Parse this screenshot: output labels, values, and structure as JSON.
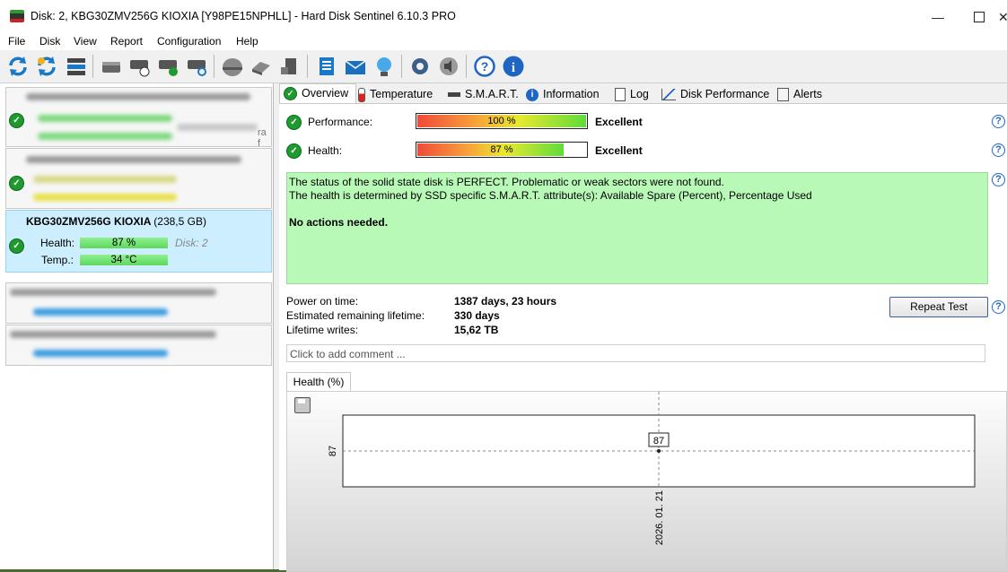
{
  "window": {
    "title": "Disk: 2, KBG30ZMV256G KIOXIA [Y98PE15NPHLL]  -  Hard Disk Sentinel 6.10.3 PRO"
  },
  "menu": [
    "File",
    "Disk",
    "View",
    "Report",
    "Configuration",
    "Help"
  ],
  "disk_list": {
    "selected": {
      "name": "KBG30ZMV256G KIOXIA",
      "size": "(238,5 GB)",
      "health_label": "Health:",
      "health_value": "87 %",
      "health_pct": 87,
      "disk_label": "Disk: 2",
      "temp_label": "Temp.:",
      "temp_value": "34 °C"
    },
    "fragment_text": "ra f"
  },
  "tabs": [
    "Overview",
    "Temperature",
    "S.M.A.R.T.",
    "Information",
    "Log",
    "Disk Performance",
    "Alerts"
  ],
  "overview": {
    "performance": {
      "label": "Performance:",
      "value": "100 %",
      "pct": 100,
      "rating": "Excellent"
    },
    "health": {
      "label": "Health:",
      "value": "87 %",
      "pct": 87,
      "rating": "Excellent"
    },
    "status_lines": [
      "The status of the solid state disk is PERFECT. Problematic or weak sectors were not found.",
      "The health is determined by SSD specific S.M.A.R.T. attribute(s):  Available Spare (Percent), Percentage Used"
    ],
    "status_action": "No actions needed.",
    "power_on_label": "Power on time:",
    "power_on_value": "1387 days, 23 hours",
    "lifetime_label": "Estimated remaining lifetime:",
    "lifetime_value": "330 days",
    "writes_label": "Lifetime writes:",
    "writes_value": "15,62 TB",
    "repeat_button": "Repeat Test",
    "comment_placeholder": "Click to add comment ..."
  },
  "chart_data": {
    "type": "line",
    "tab_label": "Health (%)",
    "x": [
      "2026. 01. 21"
    ],
    "series": [
      {
        "values": [
          87
        ]
      }
    ],
    "data_labels": [
      "87"
    ],
    "y_tick_labels": [
      "87"
    ],
    "grid": false
  },
  "colors": {
    "accent": "#1f66c4",
    "ok_green": "#1f9a2f",
    "status_bg": "#b9f9b7",
    "selected_bg": "#cdeefe"
  }
}
